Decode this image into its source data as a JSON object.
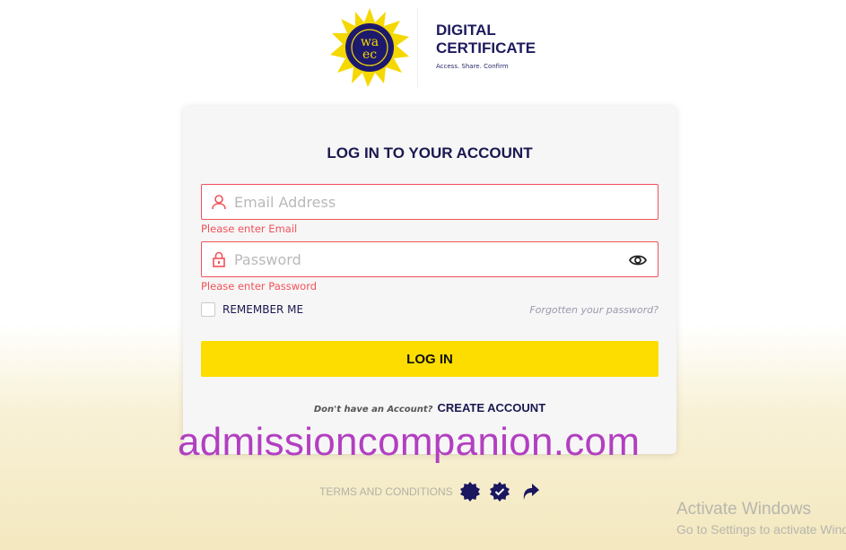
{
  "header": {
    "brand_line1": "DIGITAL",
    "brand_line2": "CERTIFICATE",
    "tagline": "Access. Share. Confirm",
    "logo_text": "waec"
  },
  "login": {
    "title": "LOG IN TO YOUR ACCOUNT",
    "email_placeholder": "Email Address",
    "email_error": "Please enter Email",
    "password_placeholder": "Password",
    "password_error": "Please enter Password",
    "remember_label": "REMEMBER ME",
    "remember_checked": false,
    "forgot_link": "Forgotten your password?",
    "login_button": "LOG IN",
    "no_account_text": "Don't have an Account?",
    "create_account_link": "CREATE ACCOUNT"
  },
  "watermark": "admissioncompanion.com",
  "footer": {
    "terms_link": "TERMS AND CONDITIONS",
    "icons": [
      "badge-icon",
      "verified-badge-icon",
      "share-icon"
    ]
  },
  "windows": {
    "line1": "Activate Windows",
    "line2": "Go to Settings to activate Windows."
  },
  "colors": {
    "error": "#f2525a",
    "accent": "#fddd00",
    "navy": "#1a1850",
    "watermark": "#b23fc0"
  }
}
